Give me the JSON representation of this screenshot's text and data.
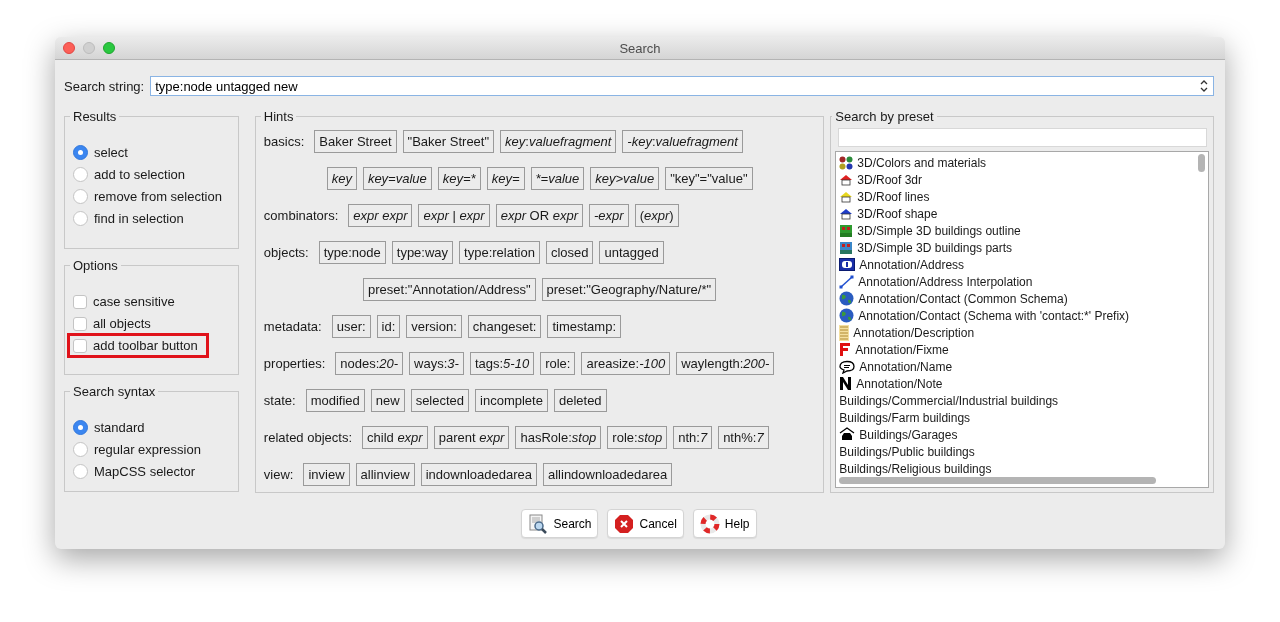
{
  "window": {
    "title": "Search"
  },
  "search": {
    "label": "Search string:",
    "value": "type:node untagged new"
  },
  "results": {
    "title": "Results",
    "options": [
      {
        "label": "select",
        "selected": true
      },
      {
        "label": "add to selection",
        "selected": false
      },
      {
        "label": "remove from selection",
        "selected": false
      },
      {
        "label": "find in selection",
        "selected": false
      }
    ]
  },
  "options": {
    "title": "Options",
    "items": [
      {
        "label": "case sensitive",
        "checked": false,
        "highlighted": false
      },
      {
        "label": "all objects",
        "checked": false,
        "highlighted": false
      },
      {
        "label": "add toolbar button",
        "checked": false,
        "highlighted": true
      }
    ]
  },
  "syntax": {
    "title": "Search syntax",
    "options": [
      {
        "label": "standard",
        "selected": true
      },
      {
        "label": "regular expression",
        "selected": false
      },
      {
        "label": "MapCSS selector",
        "selected": false
      }
    ]
  },
  "hints": {
    "title": "Hints",
    "rows": [
      {
        "label": "basics:",
        "chips": [
          [
            {
              "text": "Baker Street",
              "italic": false
            }
          ],
          [
            {
              "text": "\"Baker Street\"",
              "italic": false
            }
          ],
          [
            {
              "text": "key",
              "italic": true
            },
            {
              "text": ":",
              "italic": false
            },
            {
              "text": "valuefragment",
              "italic": true
            }
          ],
          [
            {
              "text": "-key",
              "italic": true
            },
            {
              "text": ":",
              "italic": false
            },
            {
              "text": "valuefragment",
              "italic": true
            }
          ]
        ]
      },
      {
        "chips": [
          [
            {
              "text": "key",
              "italic": true
            }
          ],
          [
            {
              "text": "key=value",
              "italic": true
            }
          ],
          [
            {
              "text": "key=*",
              "italic": true
            }
          ],
          [
            {
              "text": "key=",
              "italic": true
            }
          ],
          [
            {
              "text": "*=value",
              "italic": true
            }
          ],
          [
            {
              "text": "key>value",
              "italic": true
            }
          ],
          [
            {
              "text": "\"key\"=\"value\"",
              "italic": false
            }
          ]
        ]
      },
      {
        "label": "combinators:",
        "chips": [
          [
            {
              "text": "expr expr",
              "italic": true
            }
          ],
          [
            {
              "text": "expr",
              "italic": true
            },
            {
              "text": " | ",
              "italic": false
            },
            {
              "text": "expr",
              "italic": true
            }
          ],
          [
            {
              "text": "expr",
              "italic": true
            },
            {
              "text": " OR ",
              "italic": false
            },
            {
              "text": "expr",
              "italic": true
            }
          ],
          [
            {
              "text": "-expr",
              "italic": true
            }
          ],
          [
            {
              "text": "(",
              "italic": false
            },
            {
              "text": "expr",
              "italic": true
            },
            {
              "text": ")",
              "italic": false
            }
          ]
        ]
      },
      {
        "label": "objects:",
        "chips": [
          [
            {
              "text": "type:node",
              "italic": false
            }
          ],
          [
            {
              "text": "type:way",
              "italic": false
            }
          ],
          [
            {
              "text": "type:relation",
              "italic": false
            }
          ],
          [
            {
              "text": "closed",
              "italic": false
            }
          ],
          [
            {
              "text": "untagged",
              "italic": false
            }
          ]
        ]
      },
      {
        "chips": [
          [
            {
              "text": "preset:\"Annotation/Address\"",
              "italic": false
            }
          ],
          [
            {
              "text": "preset:\"Geography/Nature/*\"",
              "italic": false
            }
          ]
        ]
      },
      {
        "label": "metadata:",
        "chips": [
          [
            {
              "text": "user:",
              "italic": false
            }
          ],
          [
            {
              "text": "id:",
              "italic": false
            }
          ],
          [
            {
              "text": "version:",
              "italic": false
            }
          ],
          [
            {
              "text": "changeset:",
              "italic": false
            }
          ],
          [
            {
              "text": "timestamp:",
              "italic": false
            }
          ]
        ]
      },
      {
        "label": "properties:",
        "chips": [
          [
            {
              "text": "nodes:",
              "italic": false
            },
            {
              "text": "20-",
              "italic": true
            }
          ],
          [
            {
              "text": "ways:",
              "italic": false
            },
            {
              "text": "3-",
              "italic": true
            }
          ],
          [
            {
              "text": "tags:",
              "italic": false
            },
            {
              "text": "5-10",
              "italic": true
            }
          ],
          [
            {
              "text": "role:",
              "italic": false
            }
          ],
          [
            {
              "text": "areasize:",
              "italic": false
            },
            {
              "text": "-100",
              "italic": true
            }
          ],
          [
            {
              "text": "waylength:",
              "italic": false
            },
            {
              "text": "200-",
              "italic": true
            }
          ]
        ]
      },
      {
        "label": "state:",
        "chips": [
          [
            {
              "text": "modified",
              "italic": false
            }
          ],
          [
            {
              "text": "new",
              "italic": false
            }
          ],
          [
            {
              "text": "selected",
              "italic": false
            }
          ],
          [
            {
              "text": "incomplete",
              "italic": false
            }
          ],
          [
            {
              "text": "deleted",
              "italic": false
            }
          ]
        ]
      },
      {
        "label": "related objects:",
        "chips": [
          [
            {
              "text": "child ",
              "italic": false
            },
            {
              "text": "expr",
              "italic": true
            }
          ],
          [
            {
              "text": "parent ",
              "italic": false
            },
            {
              "text": "expr",
              "italic": true
            }
          ],
          [
            {
              "text": "hasRole:",
              "italic": false
            },
            {
              "text": "stop",
              "italic": true
            }
          ],
          [
            {
              "text": "role:",
              "italic": false
            },
            {
              "text": "stop",
              "italic": true
            }
          ],
          [
            {
              "text": "nth:",
              "italic": false
            },
            {
              "text": "7",
              "italic": true
            }
          ],
          [
            {
              "text": "nth%:",
              "italic": false
            },
            {
              "text": "7",
              "italic": true
            }
          ]
        ]
      },
      {
        "label": "view:",
        "chips": [
          [
            {
              "text": "inview",
              "italic": false
            }
          ],
          [
            {
              "text": "allinview",
              "italic": false
            }
          ],
          [
            {
              "text": "indownloadedarea",
              "italic": false
            }
          ],
          [
            {
              "text": "allindownloadedarea",
              "italic": false
            }
          ]
        ]
      }
    ]
  },
  "presets": {
    "title": "Search by preset",
    "items": [
      {
        "label": "3D/Colors and materials",
        "kind": "dots"
      },
      {
        "label": "3D/Roof 3dr",
        "kind": "roof",
        "color": "#e02020"
      },
      {
        "label": "3D/Roof lines",
        "kind": "roof",
        "color": "#e8d820"
      },
      {
        "label": "3D/Roof shape",
        "kind": "roof",
        "color": "#1e3cc8"
      },
      {
        "label": "3D/Simple 3D buildings outline",
        "kind": "building",
        "color": "#2e9a2e"
      },
      {
        "label": "3D/Simple 3D buildings parts",
        "kind": "building",
        "color": "#3a86c8"
      },
      {
        "label": "Annotation/Address",
        "kind": "address"
      },
      {
        "label": "Annotation/Address Interpolation",
        "kind": "line"
      },
      {
        "label": "Annotation/Contact (Common Schema)",
        "kind": "globe"
      },
      {
        "label": "Annotation/Contact (Schema with 'contact:*' Prefix)",
        "kind": "globe"
      },
      {
        "label": "Annotation/Description",
        "kind": "lines"
      },
      {
        "label": "Annotation/Fixme",
        "kind": "fixme"
      },
      {
        "label": "Annotation/Name",
        "kind": "bubble"
      },
      {
        "label": "Annotation/Note",
        "kind": "note"
      },
      {
        "label": "Buildings/Commercial/Industrial buildings",
        "kind": "none"
      },
      {
        "label": "Buildings/Farm buildings",
        "kind": "none"
      },
      {
        "label": "Buildings/Garages",
        "kind": "car"
      },
      {
        "label": "Buildings/Public buildings",
        "kind": "none"
      },
      {
        "label": "Buildings/Religious buildings",
        "kind": "none"
      }
    ]
  },
  "buttons": [
    {
      "label": "Search",
      "kind": "search"
    },
    {
      "label": "Cancel",
      "kind": "cancel"
    },
    {
      "label": "Help",
      "kind": "help"
    }
  ]
}
